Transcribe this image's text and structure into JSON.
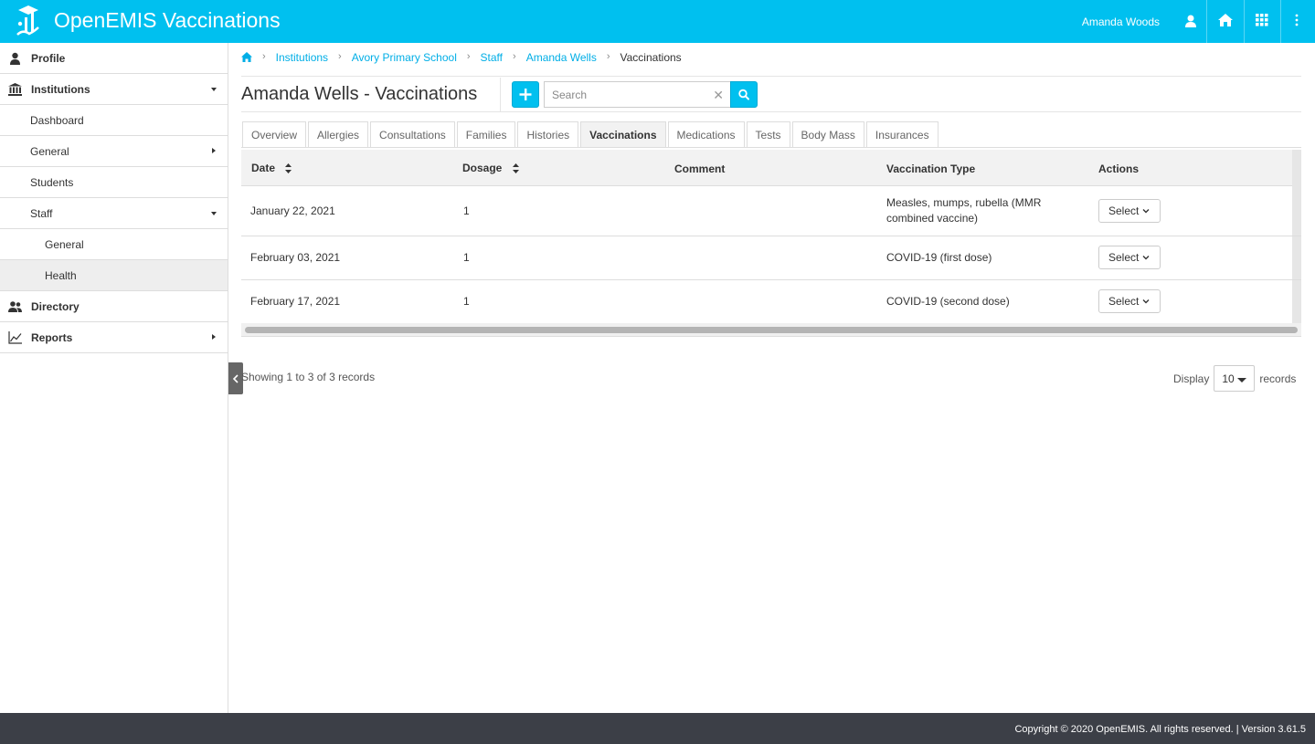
{
  "header": {
    "app_title": "OpenEMIS Vaccinations",
    "user_name": "Amanda Woods",
    "icons": [
      "user-icon",
      "home-icon",
      "apps-grid-icon",
      "more-vertical-icon"
    ],
    "color": "#00c0ef"
  },
  "sidebar": {
    "items": [
      {
        "label": "Profile",
        "icon": "user-icon"
      },
      {
        "label": "Institutions",
        "icon": "institution-icon"
      },
      {
        "label": "Dashboard"
      },
      {
        "label": "General"
      },
      {
        "label": "Students"
      },
      {
        "label": "Staff"
      },
      {
        "label": "General"
      },
      {
        "label": "Health"
      },
      {
        "label": "Directory",
        "icon": "users-icon"
      },
      {
        "label": "Reports",
        "icon": "chart-icon"
      }
    ]
  },
  "breadcrumb": {
    "home_icon": "home-icon",
    "items": [
      "Institutions",
      "Avory Primary School",
      "Staff",
      "Amanda Wells"
    ],
    "current": "Vaccinations"
  },
  "page": {
    "title": "Amanda Wells - Vaccinations",
    "search_placeholder": "Search"
  },
  "tabs": [
    "Overview",
    "Allergies",
    "Consultations",
    "Families",
    "Histories",
    "Vaccinations",
    "Medications",
    "Tests",
    "Body Mass",
    "Insurances"
  ],
  "active_tab": "Vaccinations",
  "table": {
    "columns": [
      "Date",
      "Dosage",
      "Comment",
      "Vaccination Type",
      "Actions"
    ],
    "rows": [
      {
        "date": "January 22, 2021",
        "dosage": "1",
        "comment": "",
        "type": "Measles, mumps, rubella (MMR combined vaccine)",
        "action": "Select"
      },
      {
        "date": "February 03, 2021",
        "dosage": "1",
        "comment": "",
        "type": "COVID-19 (first dose)",
        "action": "Select"
      },
      {
        "date": "February 17, 2021",
        "dosage": "1",
        "comment": "",
        "type": "COVID-19 (second dose)",
        "action": "Select"
      }
    ]
  },
  "pagination": {
    "info": "Showing 1 to 3 of 3 records",
    "display_label": "Display",
    "display_value": "10",
    "records_label": "records"
  },
  "footer": {
    "text": "Copyright © 2020 OpenEMIS. All rights reserved. | Version 3.61.5"
  }
}
